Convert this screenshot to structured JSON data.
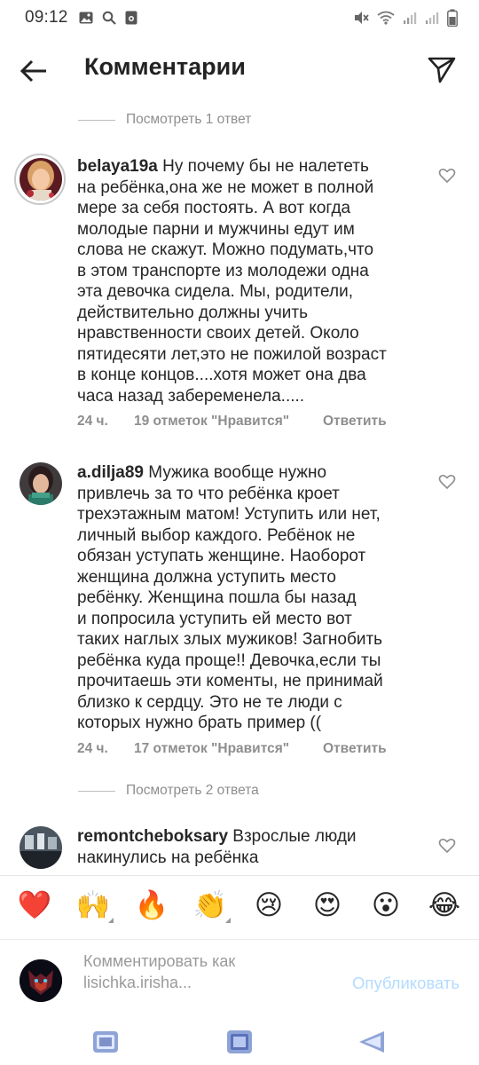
{
  "status_bar": {
    "time": "09:12"
  },
  "header": {
    "title": "Комментарии"
  },
  "view_replies_top": "Посмотреть 1 ответ",
  "comments": [
    {
      "username": "belaya19a",
      "text": " Ну почему бы не налететь\nна ребёнка,она же не может в полной\nмере за себя постоять. А вот когда\nмолодые парни и мужчины едут им\nслова не скажут. Можно подумать,что\nв этом транспорте из молодежи одна\nэта девочка сидела. Мы, родители,\nдействительно должны учить\nнравственности своих детей. Около\nпятидесяти лет,это не пожилой возраст\nв конце концов....хотя может она два\nчаса назад забеременела.....",
      "time": "24 ч.",
      "likes": "19 отметок \"Нравится\"",
      "reply": "Ответить"
    },
    {
      "username": "a.dilja89",
      "text": " Мужика вообще нужно\nпривлечь за то что ребёнка кроет\nтрехэтажным матом! Уступить или нет,\nличный выбор каждого.  Ребёнок не\nобязан уступать женщине. Наоборот\nженщина должна уступить место\nребёнку. Женщина пошла бы назад\nи попросила уступить ей место вот\nтаких наглых злых мужиков! Загнобить\nребёнка куда проще!! Девочка,если ты\nпрочитаешь эти коменты, не принимай\nблизко к сердцу. Это не те люди с\nкоторых нужно брать пример ((",
      "time": "24 ч.",
      "likes": "17 отметок \"Нравится\"",
      "reply": "Ответить"
    },
    {
      "username": "remontcheboksary",
      "text": " Взрослые люди\nнакинулись на ребёнка"
    }
  ],
  "view_replies_second": "Посмотреть 2 ответа",
  "emoji_bar": [
    "❤️",
    "🙌",
    "🔥",
    "👏",
    "😢",
    "😍",
    "😮",
    "😂"
  ],
  "input": {
    "placeholder": "Комментировать как\nlisichka.irisha...",
    "publish_label": "Опубликовать"
  },
  "colors": {
    "meta_gray": "#8e8e8e",
    "publish_disabled": "#b3dbff",
    "text": "#262626"
  }
}
